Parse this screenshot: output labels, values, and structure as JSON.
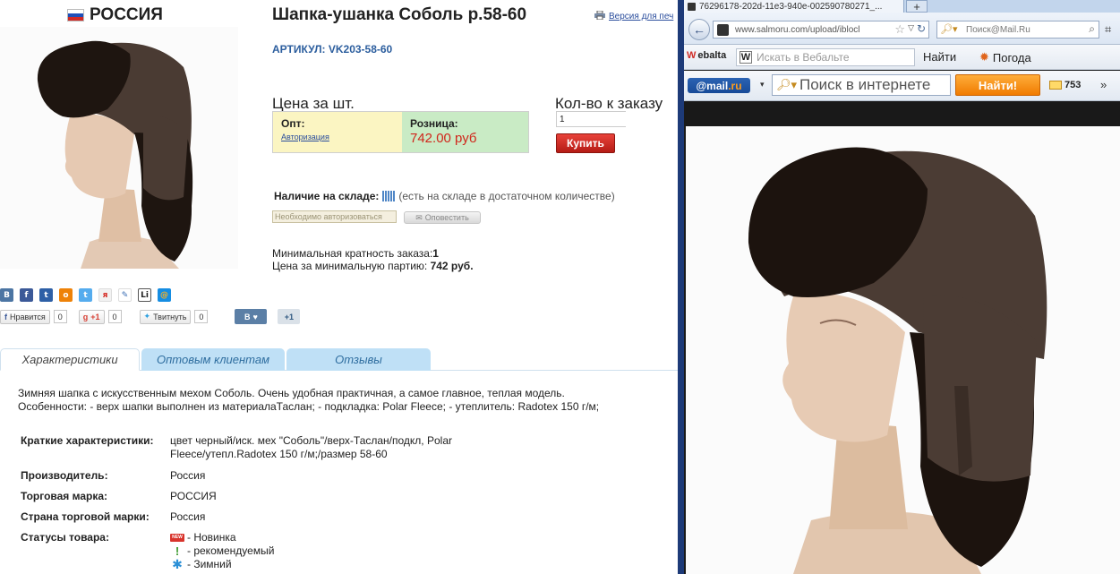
{
  "left": {
    "brand": "РОССИЯ",
    "title": "Шапка-ушанка Соболь р.58-60",
    "print_link": "Версия для печ",
    "article": "АРТИКУЛ: VK203-58-60",
    "price_heading": "Цена за шт.",
    "qty_heading": "Кол-во к заказу",
    "opt_label": "Опт:",
    "opt_link": "Авторизация",
    "retail_label": "Розница:",
    "retail_value": "742.00 руб",
    "qty_value": "1",
    "buy_label": "Купить",
    "stock_label": "Наличие на складе:",
    "stock_desc": "(есть на складе в достаточном количестве)",
    "need_auth": "Необходимо авторизоваться",
    "notify_label": "Оповестить",
    "min_order_label": "Минимальная кратность заказа:",
    "min_order_value": "1",
    "min_price_label": "Цена за минимальную партию:",
    "min_price_value": "742 руб.",
    "share_icons": [
      "В",
      "f",
      "t",
      "о",
      "t",
      "я",
      "✎",
      "Li",
      "@"
    ],
    "social": {
      "fb_label": "Нравится",
      "fb_count": "0",
      "gplus_label": "+1",
      "gplus_count": "0",
      "tw_label": "Твитнуть",
      "tw_count": "0",
      "vk_label": "В",
      "vk_count": "+1"
    },
    "tabs": [
      "Характеристики",
      "Оптовым клиентам",
      "Отзывы"
    ],
    "description_1": "Зимняя шапка с искусственным мехом Соболь. Очень удобная практичная, а самое главное, теплая модель.",
    "description_2": "Особенности: - верх шапки выполнен из материалаТаслан; - подкладка: Polar Fleece; - утеплитель: Radotex 150 г/м;",
    "specs": [
      {
        "key": "Краткие характеристики:",
        "value": "цвет черный/иск. мех \"Соболь\"/верх-Таслан/подкл, Polar Fleece/утепл.Radotex 150 г/м;/размер 58-60"
      },
      {
        "key": "Производитель:",
        "value": "Россия"
      },
      {
        "key": "Торговая марка:",
        "value": "РОССИЯ"
      },
      {
        "key": "Страна торговой марки:",
        "value": "Россия"
      }
    ],
    "status_key": "Статусы товара:",
    "statuses": [
      "- Новинка",
      "- рекомендуемый",
      "- Зимний"
    ],
    "new_badge": "NEW"
  },
  "browser": {
    "tab_title": "76296178-202d-11e3-940e-002590780271_...",
    "new_tab": "+",
    "url": "www.salmoru.com/upload/iblocl",
    "search_placeholder": "Поиск@Mail.Ru",
    "webalta_logo": "ebalta",
    "webalta_placeholder": "Искать в Вебальте",
    "webalta_find": "Найти",
    "weather": "Погода",
    "mail_logo_a": "@mail",
    "mail_logo_b": ".ru",
    "mail_placeholder": "Поиск в интернете",
    "mail_go": "Найти!",
    "mail_count": "753",
    "more": "»"
  },
  "colors": {
    "retail_price": "#d0261b",
    "article": "#2c5e9e",
    "divider": "#1d3a78",
    "buy": "#c4231c",
    "mail_go": "#f07b00"
  }
}
